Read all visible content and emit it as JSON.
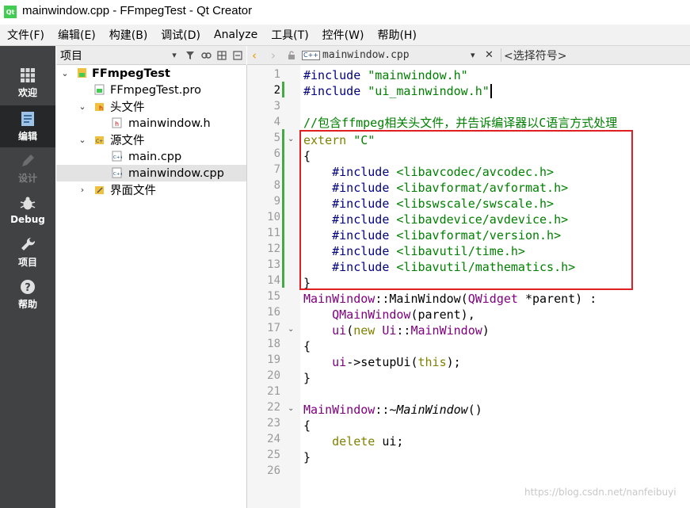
{
  "window": {
    "logo": "Qt",
    "title": "mainwindow.cpp - FFmpegTest - Qt Creator"
  },
  "menubar": {
    "items": [
      "文件(F)",
      "编辑(E)",
      "构建(B)",
      "调试(D)",
      "Analyze",
      "工具(T)",
      "控件(W)",
      "帮助(H)"
    ]
  },
  "sidebar": {
    "modes": [
      {
        "label": "欢迎",
        "icon": "grid-icon"
      },
      {
        "label": "编辑",
        "icon": "document-icon"
      },
      {
        "label": "设计",
        "icon": "pen-icon"
      },
      {
        "label": "Debug",
        "icon": "bug-icon"
      },
      {
        "label": "项目",
        "icon": "wrench-icon"
      },
      {
        "label": "帮助",
        "icon": "help-icon"
      }
    ]
  },
  "project_pane": {
    "title": "项目",
    "tree": [
      {
        "label": "FFmpegTest",
        "icon": "project-icon",
        "expanded": true
      },
      {
        "label": "FFmpegTest.pro",
        "icon": "pro-file-icon"
      },
      {
        "label": "头文件",
        "icon": "header-folder-icon",
        "expanded": true
      },
      {
        "label": "mainwindow.h",
        "icon": "header-file-icon"
      },
      {
        "label": "源文件",
        "icon": "source-folder-icon",
        "expanded": true
      },
      {
        "label": "main.cpp",
        "icon": "cpp-file-icon"
      },
      {
        "label": "mainwindow.cpp",
        "icon": "cpp-file-icon",
        "selected": true
      },
      {
        "label": "界面文件",
        "icon": "forms-folder-icon",
        "expanded": false
      }
    ]
  },
  "editor_header": {
    "file_badge": "C++",
    "file": "mainwindow.cpp",
    "symbol_placeholder": "<选择符号>"
  },
  "code": {
    "line_numbers": [
      "1",
      "2",
      "3",
      "4",
      "5",
      "6",
      "7",
      "8",
      "9",
      "10",
      "11",
      "12",
      "13",
      "14",
      "15",
      "16",
      "17",
      "18",
      "19",
      "20",
      "21",
      "22",
      "23",
      "24",
      "25",
      "26"
    ],
    "l1_kw": "#include",
    "l1_str": "\"mainwindow.h\"",
    "l2_kw": "#include",
    "l2_str": "\"ui_mainwindow.h\"",
    "l4": "//包含ffmpeg相关头文件，并告诉编译器以C语言方式处理",
    "l5_kw": "extern",
    "l5_str": "\"C\"",
    "l6": "{",
    "inc": "#include",
    "l7": "<libavcodec/avcodec.h>",
    "l8": "<libavformat/avformat.h>",
    "l9": "<libswscale/swscale.h>",
    "l10": "<libavdevice/avdevice.h>",
    "l11": "<libavformat/version.h>",
    "l12": "<libavutil/time.h>",
    "l13": "<libavutil/mathematics.h>",
    "l14": "}",
    "l15_a": "MainWindow",
    "l15_b": "::",
    "l15_c": "MainWindow",
    "l15_d": "(",
    "l15_e": "QWidget",
    "l15_f": " *parent) :",
    "l16_a": "QMainWindow",
    "l16_b": "(parent),",
    "l17_a": "ui",
    "l17_b": "(",
    "l17_c": "new",
    "l17_d": " ",
    "l17_e": "Ui",
    "l17_f": "::",
    "l17_g": "MainWindow",
    "l17_h": ")",
    "l18": "{",
    "l19_a": "ui",
    "l19_b": "->setupUi(",
    "l19_c": "this",
    "l19_d": ");",
    "l20": "}",
    "l22_a": "MainWindow",
    "l22_b": "::~",
    "l22_c": "MainWindow",
    "l22_d": "()",
    "l23": "{",
    "l24_a": "delete",
    "l24_b": " ui;",
    "l25": "}"
  },
  "watermark": "https://blog.csdn.net/nanfeibuyi",
  "colors": {
    "sidebar": "#404244",
    "sidebar_active": "#262728",
    "highlight_box": "#e02020",
    "keyword": "#808000",
    "preprocessor": "#000080",
    "string": "#008000",
    "type": "#800080"
  }
}
